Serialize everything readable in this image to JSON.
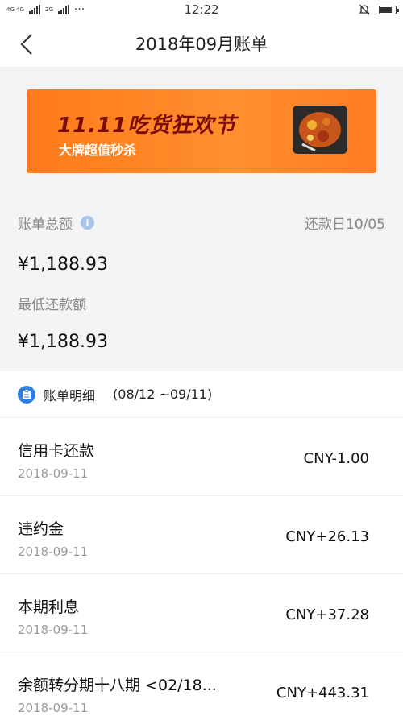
{
  "status_bar": {
    "network_left": "4G 4G",
    "network_right": "2G",
    "dots": "···",
    "time": "12:22"
  },
  "nav": {
    "title": "2018年09月账单"
  },
  "banner": {
    "headline": "11.11吃货狂欢节",
    "subline": "大牌超值秒杀"
  },
  "summary": {
    "total_label": "账单总额",
    "info_icon_text": "i",
    "due_date": "还款日10/05",
    "total_amount": "¥1,188.93",
    "min_label": "最低还款额",
    "min_amount": "¥1,188.93"
  },
  "detail": {
    "label": "账单明细",
    "range": "(08/12 ~09/11)"
  },
  "transactions": [
    {
      "name": "信用卡还款",
      "date": "2018-09-11",
      "amount": "CNY-1.00"
    },
    {
      "name": "违约金",
      "date": "2018-09-11",
      "amount": "CNY+26.13"
    },
    {
      "name": "本期利息",
      "date": "2018-09-11",
      "amount": "CNY+37.28"
    },
    {
      "name": "余额转分期十八期 <02/18...",
      "date": "2018-09-11",
      "amount": "CNY+443.31"
    }
  ],
  "colors": {
    "banner_orange": "#ff8a28",
    "headline_red": "#7a0b08",
    "accent_blue": "#2d7fe0",
    "info_blue": "#a9c4ea",
    "background_gray": "#f3f4f6"
  },
  "icons": {
    "back": "chevron-left-icon",
    "info": "info-icon",
    "detail": "document-icon",
    "mute": "bell-off-icon",
    "battery": "battery-icon"
  }
}
